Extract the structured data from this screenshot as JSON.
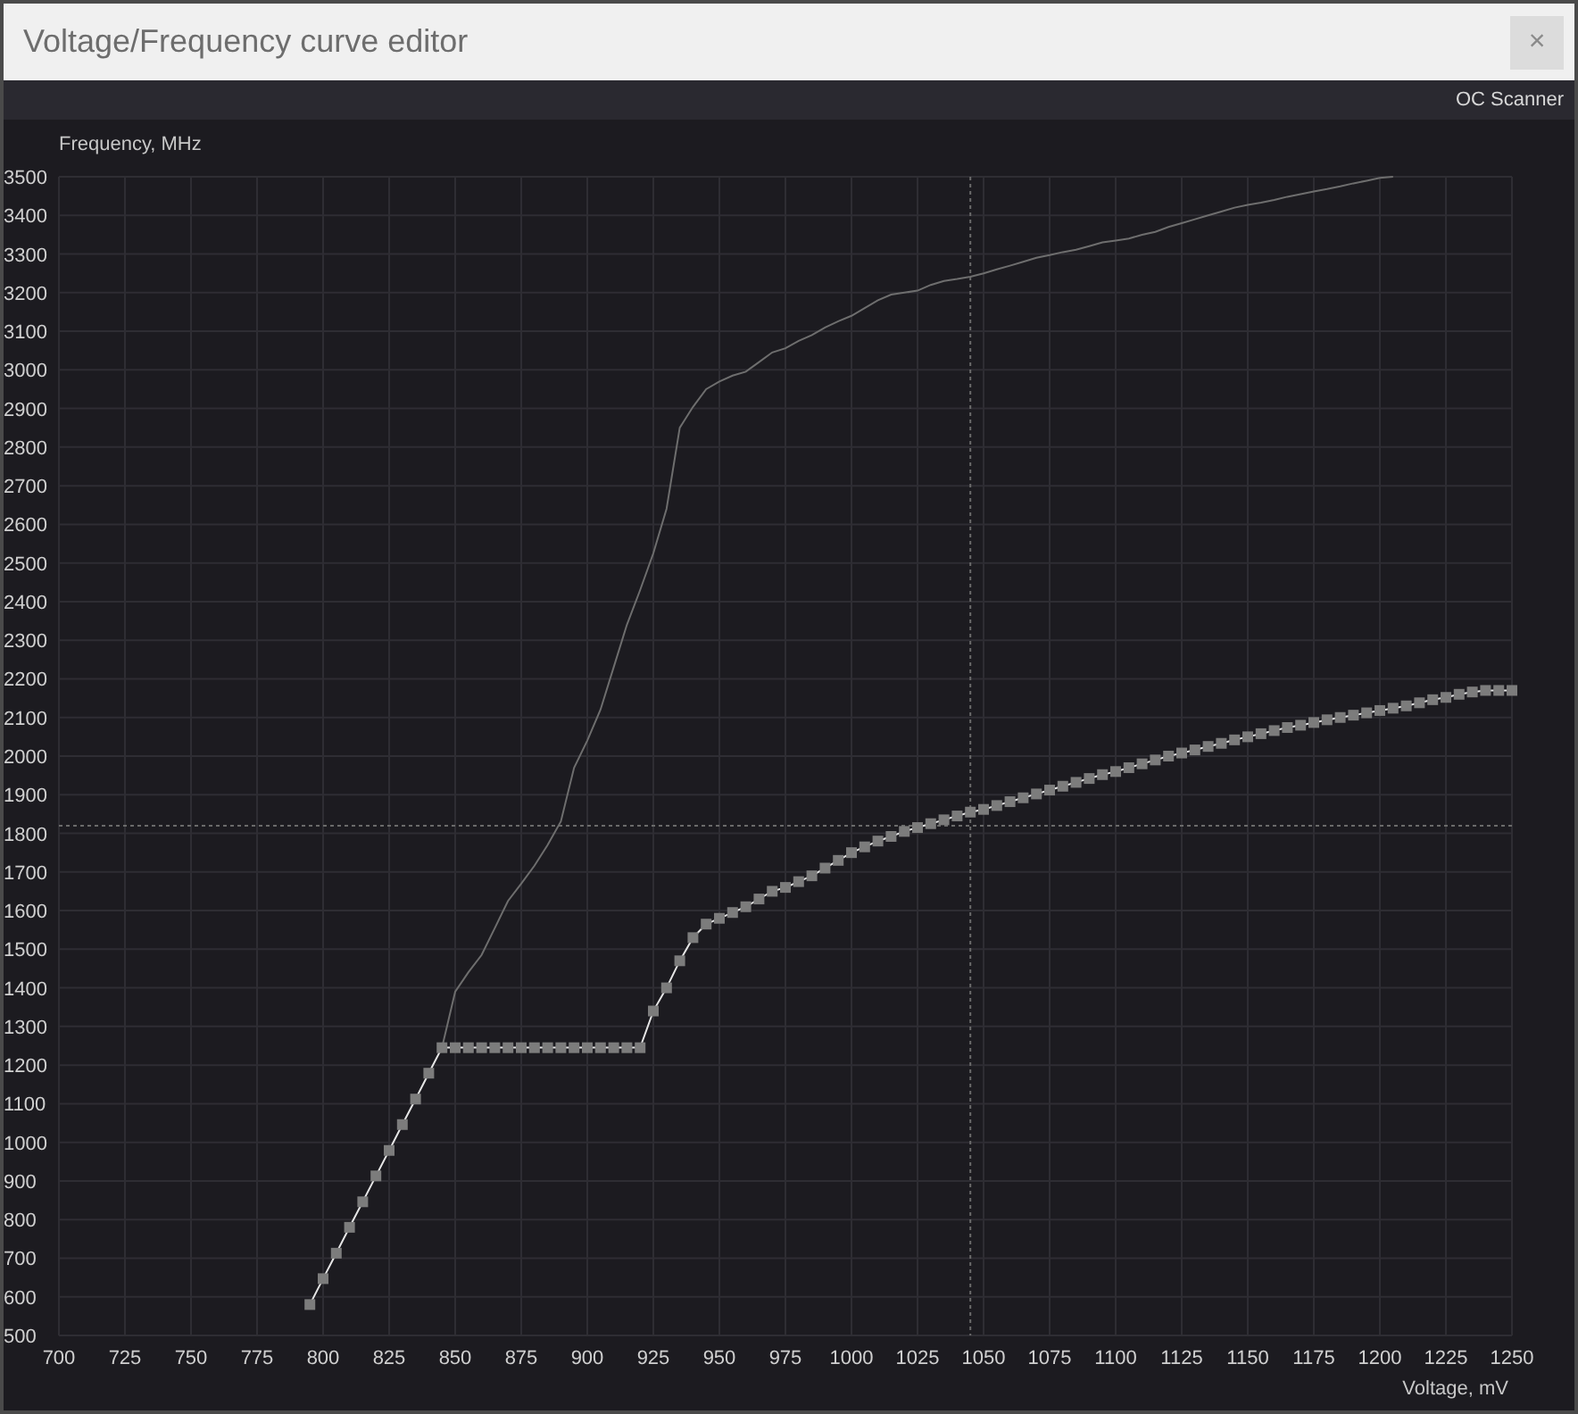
{
  "window": {
    "title": "Voltage/Frequency curve editor",
    "close": "×"
  },
  "toolbar": {
    "button": "OC Scanner"
  },
  "chart": {
    "chart_data": {
      "type": "line",
      "xlabel": "Voltage, mV",
      "ylabel": "Frequency, MHz",
      "xlim": [
        700,
        1250
      ],
      "ylim": [
        500,
        3500
      ],
      "xticks": [
        700,
        725,
        750,
        775,
        800,
        825,
        850,
        875,
        900,
        925,
        950,
        975,
        1000,
        1025,
        1050,
        1075,
        1100,
        1125,
        1150,
        1175,
        1200,
        1225,
        1250
      ],
      "yticks": [
        500,
        600,
        700,
        800,
        900,
        1000,
        1100,
        1200,
        1300,
        1400,
        1500,
        1600,
        1700,
        1800,
        1900,
        2000,
        2100,
        2200,
        2300,
        2400,
        2500,
        2600,
        2700,
        2800,
        2900,
        3000,
        3100,
        3200,
        3300,
        3400,
        3500
      ],
      "x": [
        795,
        800,
        805,
        810,
        815,
        820,
        825,
        830,
        835,
        840,
        845,
        850,
        855,
        860,
        865,
        870,
        875,
        880,
        885,
        890,
        895,
        900,
        905,
        910,
        915,
        920,
        925,
        930,
        935,
        940,
        945,
        950,
        955,
        960,
        965,
        970,
        975,
        980,
        985,
        990,
        995,
        1000,
        1005,
        1010,
        1015,
        1020,
        1025,
        1030,
        1035,
        1040,
        1045,
        1050,
        1055,
        1060,
        1065,
        1070,
        1075,
        1080,
        1085,
        1090,
        1095,
        1100,
        1105,
        1110,
        1115,
        1120,
        1125,
        1130,
        1135,
        1140,
        1145,
        1150,
        1155,
        1160,
        1165,
        1170,
        1175,
        1180,
        1185,
        1190,
        1195,
        1200,
        1205,
        1210,
        1215,
        1220,
        1225,
        1230,
        1235,
        1240,
        1245,
        1250
      ],
      "series": [
        {
          "color": "#e6e6e6",
          "marker": "square",
          "values": [
            580,
            647,
            713,
            780,
            846,
            913,
            979,
            1046,
            1112,
            1179,
            1245,
            1245,
            1245,
            1245,
            1245,
            1245,
            1245,
            1245,
            1245,
            1245,
            1245,
            1245,
            1245,
            1245,
            1245,
            1245,
            1340,
            1400,
            1470,
            1530,
            1565,
            1580,
            1595,
            1610,
            1630,
            1650,
            1660,
            1675,
            1690,
            1710,
            1730,
            1750,
            1765,
            1780,
            1792,
            1805,
            1815,
            1825,
            1835,
            1845,
            1855,
            1862,
            1872,
            1882,
            1892,
            1902,
            1912,
            1922,
            1932,
            1942,
            1952,
            1960,
            1970,
            1980,
            1990,
            2000,
            2008,
            2016,
            2025,
            2033,
            2042,
            2050,
            2058,
            2066,
            2074,
            2080,
            2087,
            2094,
            2100,
            2106,
            2112,
            2118,
            2124,
            2130,
            2138,
            2146,
            2152,
            2160,
            2166,
            2170,
            2170,
            2170
          ]
        },
        {
          "color": "#6e6e6e",
          "values": [
            null,
            null,
            null,
            null,
            null,
            null,
            null,
            null,
            null,
            null,
            1245,
            1390,
            1440,
            1485,
            1555,
            1625,
            1670,
            1716,
            1770,
            1831,
            1970,
            2040,
            2120,
            2230,
            2340,
            2430,
            2525,
            2640,
            2850,
            2904,
            2950,
            2970,
            2985,
            2995,
            3020,
            3045,
            3056,
            3075,
            3090,
            3110,
            3126,
            3140,
            3160,
            3180,
            3195,
            3200,
            3205,
            3220,
            3230,
            3235,
            3241,
            3250,
            3260,
            3270,
            3280,
            3290,
            3297,
            3305,
            3311,
            3320,
            3330,
            3335,
            3340,
            3350,
            3357,
            3370,
            3380,
            3390,
            3400,
            3410,
            3420,
            3427,
            3433,
            3440,
            3448,
            3455,
            3462,
            3468,
            3475,
            3483,
            3490,
            3497,
            3500,
            null,
            null,
            null,
            null,
            null,
            null,
            null,
            null,
            null
          ]
        }
      ],
      "grid": true,
      "ref_lines": [
        {
          "axis": "x",
          "value": 1045
        },
        {
          "axis": "y",
          "value": 1820
        }
      ]
    }
  }
}
